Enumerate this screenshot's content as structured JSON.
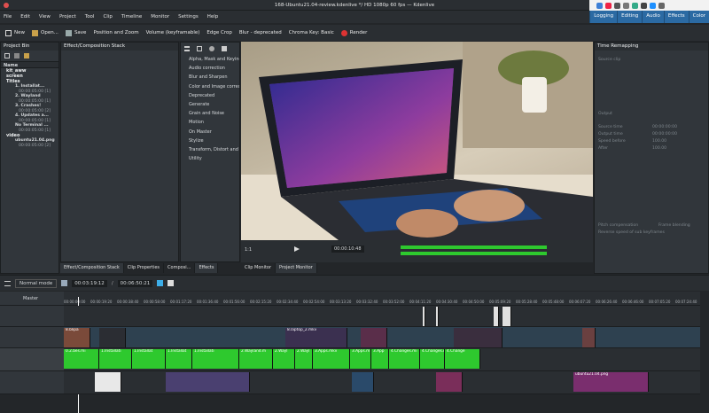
{
  "window": {
    "title": "168-Ubuntu21.04-review.kdenlive */ HD 1080p 60 fps — Kdenlive"
  },
  "menu": [
    "File",
    "Edit",
    "View",
    "Project",
    "Tool",
    "Clip",
    "Timeline",
    "Monitor",
    "Settings",
    "Help"
  ],
  "toolbar": {
    "new": "New",
    "open": "Open...",
    "save": "Save",
    "pos_zoom": "Position and Zoom",
    "volume": "Volume (keyframable)",
    "edge_crop": "Edge Crop",
    "blur": "Blur - deprecated",
    "chroma": "Chroma Key: Basic",
    "render": "Render"
  },
  "layouts": [
    "Logging",
    "Editing",
    "Audio",
    "Effects",
    "Color"
  ],
  "bin": {
    "title": "Project Bin",
    "col": "Name",
    "folders": [
      "kit_aww",
      "screen",
      "Titles"
    ],
    "items": [
      {
        "name": "1. Installat...",
        "dur": "00:00:05:00 [1]"
      },
      {
        "name": "2. Wayland",
        "dur": "00:00:05:00 [1]"
      },
      {
        "name": "3. Crashes!",
        "dur": "00:00:05:00 [2]"
      },
      {
        "name": "4. Updates a...",
        "dur": "00:00:05:00 [1]"
      },
      {
        "name": "No Terminal ...",
        "dur": "00:00:05:00 [1]"
      }
    ],
    "video": "video",
    "png": "ubuntu21.04.png",
    "png_dur": "00:00:05:00 [2]"
  },
  "fxstack": {
    "title": "Effect/Composition Stack"
  },
  "fxlist": [
    "Alpha, Mask and Keying",
    "Audio correction",
    "Blur and Sharpen",
    "Color and Image correction",
    "Deprecated",
    "Generate",
    "Grain and Noise",
    "Motion",
    "On Master",
    "Stylize",
    "Transform, Distort and Perspective",
    "Utility"
  ],
  "tabs_left": [
    "Effect/Composition Stack",
    "Clip Properties",
    "Composi...",
    "Effects"
  ],
  "tabs_mon": [
    "Clip Monitor",
    "Project Monitor"
  ],
  "monitor": {
    "zoom": "1:1",
    "timecode": "00:00:10:48"
  },
  "remap": {
    "title": "Time Remapping",
    "source": "Source clip",
    "output": "Output",
    "source_time": "Source time",
    "output_time": "Output time",
    "speed_before": "Speed before",
    "after": "After",
    "t1": "00:00:00:00",
    "t2": "00:00:00:00",
    "v1": "100.00",
    "v2": "100.00",
    "pitch": "Pitch compensation",
    "frame": "Frame blending",
    "reverse": "Reverse speed of sub keyframes"
  },
  "tltoolbar": {
    "mode": "Normal mode",
    "tc1": "00:03:19:12",
    "tc2": "00:06:50:21"
  },
  "timeline": {
    "master": "Master",
    "ticks": [
      "00:00:00:00",
      "00:00:19:20",
      "00:00:38:40",
      "00:00:58:00",
      "00:01:17:20",
      "00:01:36:40",
      "00:01:56:00",
      "00:02:15:20",
      "00:02:34:40",
      "00:02:54:00",
      "00:03:13:20",
      "00:03:32:40",
      "00:03:52:00",
      "00:04:11:20",
      "00:04:30:40",
      "00:04:50:00",
      "00:05:09:20",
      "00:05:28:40",
      "00:05:48:00",
      "00:06:07:20",
      "00:06:26:40",
      "00:06:46:00",
      "00:07:05:20",
      "00:07:24:40"
    ],
    "clips": [
      "0.2.bes.mi",
      "1.Installati",
      "1.Installat",
      "1.Installat",
      "1.Installati",
      "2.Wayland.m",
      "2.Wayl",
      "2.Wayl",
      "3.Apps.mkv",
      "3.Apps.m",
      "3.App",
      "4.Changes.mi",
      "4.Changes.mi",
      "4.Change"
    ],
    "v1clips": [
      "8.blipa",
      "8.laptop_2.mkv",
      "ubuntu21.04.png"
    ]
  },
  "colors": {
    "accent": "#3daee9",
    "green": "#2ec92e",
    "bg": "#232629"
  }
}
